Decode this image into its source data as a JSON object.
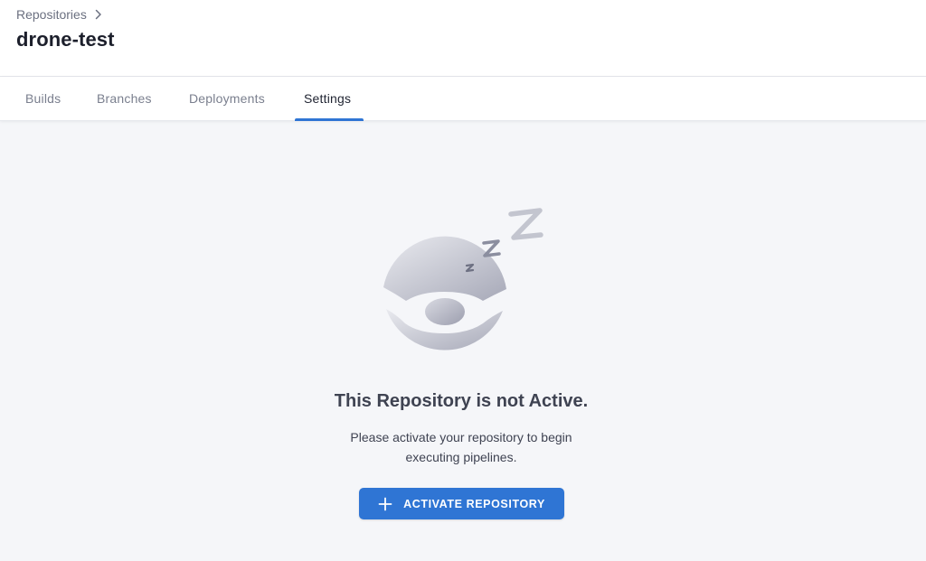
{
  "breadcrumb": {
    "root_label": "Repositories",
    "separator_icon": "chevron-right-icon"
  },
  "page": {
    "title": "drone-test"
  },
  "tabs": [
    {
      "label": "Builds",
      "active": false
    },
    {
      "label": "Branches",
      "active": false
    },
    {
      "label": "Deployments",
      "active": false
    },
    {
      "label": "Settings",
      "active": true
    }
  ],
  "empty_state": {
    "illustration_icon": "sleeping-drone-icon",
    "title": "This Repository is not Active.",
    "description": "Please activate your repository to begin executing pipelines.",
    "button_label": "ACTIVATE REPOSITORY",
    "button_icon": "plus-icon"
  },
  "colors": {
    "accent": "#2f75d4",
    "background": "#f5f6f9",
    "header_bg": "#ffffff",
    "text_muted": "#7a7f8e"
  }
}
